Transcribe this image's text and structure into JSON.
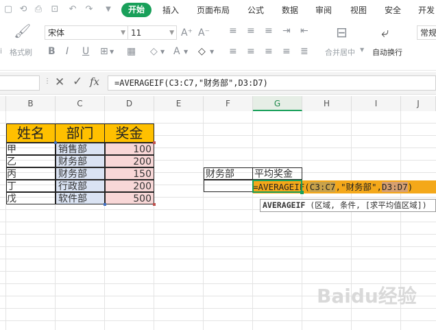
{
  "menu": {
    "tabs": [
      {
        "label": "开始"
      },
      {
        "label": "插入"
      },
      {
        "label": "页面布局"
      },
      {
        "label": "公式"
      },
      {
        "label": "数据"
      },
      {
        "label": "审阅"
      },
      {
        "label": "视图"
      },
      {
        "label": "安全"
      },
      {
        "label": "开发"
      }
    ]
  },
  "ribbon": {
    "format_painter_label": "格式刷",
    "font_name": "宋体",
    "font_size": "11",
    "merge_label": "合并居中",
    "wrap_label": "自动换行",
    "number_format": "常规"
  },
  "formula_bar": {
    "fx_label": "fx",
    "formula": "=AVERAGEIF(C3:C7,\"财务部\",D3:D7)"
  },
  "columns": [
    "B",
    "C",
    "D",
    "E",
    "F",
    "G",
    "H",
    "I",
    "J"
  ],
  "table": {
    "headers": [
      "姓名",
      "部门",
      "奖金"
    ],
    "rows": [
      {
        "name": "甲",
        "dept": "销售部",
        "bonus": "100"
      },
      {
        "name": "乙",
        "dept": "财务部",
        "bonus": "200"
      },
      {
        "name": "丙",
        "dept": "财务部",
        "bonus": "150"
      },
      {
        "name": "丁",
        "dept": "行政部",
        "bonus": "200"
      },
      {
        "name": "戊",
        "dept": "软件部",
        "bonus": "500"
      }
    ]
  },
  "criteria": {
    "f_label": "财务部",
    "g_label": "平均奖金"
  },
  "edit": {
    "prefix": "=AVERAGEIF(",
    "ref1": "C3:C7",
    "mid": ",\"财务部\",",
    "ref2": "D3:D7",
    "suffix": ")"
  },
  "tooltip": {
    "fn": "AVERAGEIF",
    "args": " (区域, 条件, [求平均值区域])"
  },
  "watermark": "Baidu经验",
  "colors": {
    "accent": "#19a05a",
    "header_fill": "#ffc000",
    "edit_fill": "#f4a81a",
    "dept_range": "#dae3f3",
    "bonus_range": "#f8d7d7"
  }
}
